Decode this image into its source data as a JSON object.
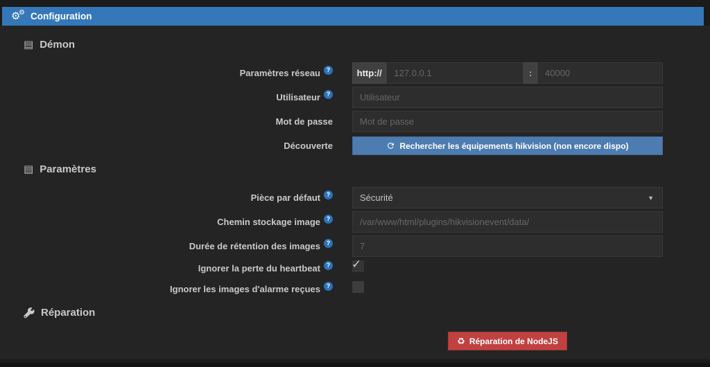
{
  "header": {
    "title": "Configuration"
  },
  "icons": {
    "gear": "⚙",
    "list": "▤",
    "help": "?",
    "caret_down": "▼",
    "check": "✓",
    "recycle": "♻"
  },
  "sections": {
    "daemon": {
      "title": "Démon"
    },
    "parameters": {
      "title": "Paramètres"
    },
    "repair": {
      "title": "Réparation"
    }
  },
  "fields": {
    "network": {
      "label": "Paramètres réseau",
      "protocol_addon": "http://",
      "ip_placeholder": "127.0.0.1",
      "separator": ":",
      "port_placeholder": "40000"
    },
    "user": {
      "label": "Utilisateur",
      "placeholder": "Utilisateur"
    },
    "password": {
      "label": "Mot de passe",
      "placeholder": "Mot de passe"
    },
    "discovery": {
      "label": "Découverte",
      "button_label": "Rechercher les équipements hikvision (non encore dispo)"
    },
    "default_room": {
      "label": "Pièce par défaut",
      "value": "Sécurité"
    },
    "image_path": {
      "label": "Chemin stockage image",
      "placeholder": "/var/www/html/plugins/hikvisionevent/data/"
    },
    "retention": {
      "label": "Durée de rétention des images",
      "placeholder": "7"
    },
    "ignore_heartbeat": {
      "label": "Ignorer la perte du heartbeat",
      "checked": true
    },
    "ignore_alarm_images": {
      "label": "Ignorer les images d'alarme reçues",
      "checked": false
    }
  },
  "repair": {
    "button_label": "Réparation de NodeJS"
  },
  "colors": {
    "header_blue": "#3478ba",
    "button_blue": "#4d7cb0",
    "button_red": "#c14141",
    "help_blue": "#2c72b8",
    "panel_bg": "#242424",
    "input_bg": "#2d2d2d"
  }
}
